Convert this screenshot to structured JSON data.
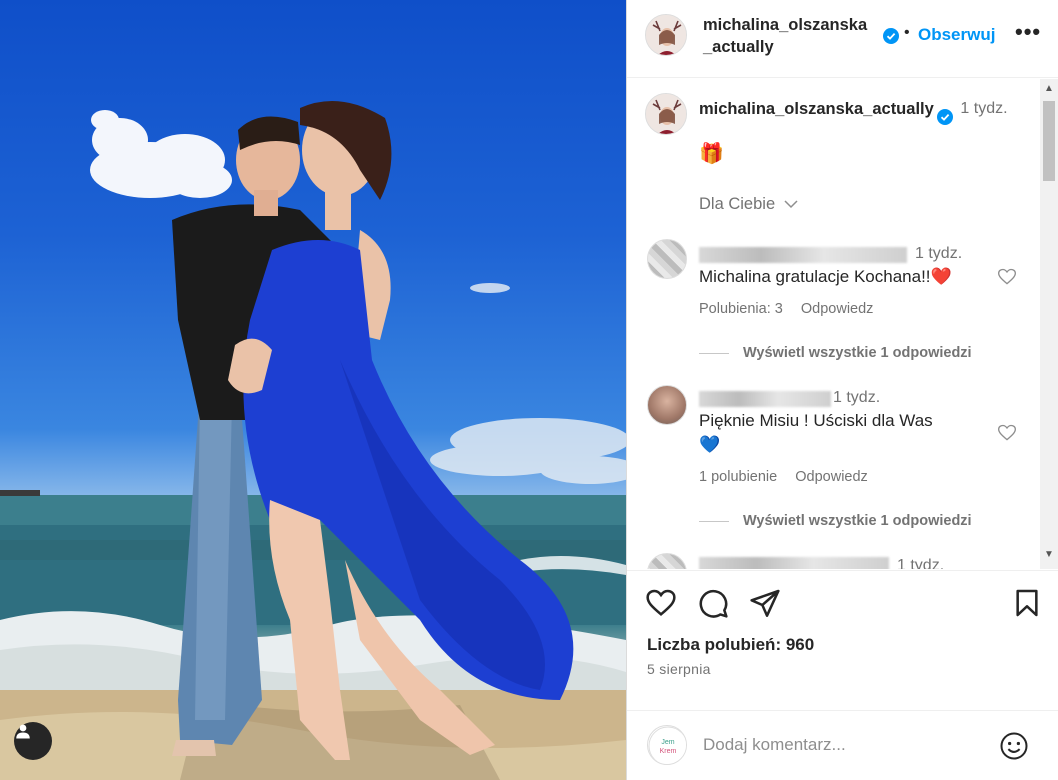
{
  "post": {
    "username": "michalina_olszanska_actually",
    "follow_label": "Obserwuj",
    "separator": "•",
    "more_label": "•••"
  },
  "caption": {
    "username": "michalina_olszanska_actually",
    "time": "1 tydz.",
    "emoji": "🎁"
  },
  "filter": {
    "label": "Dla Ciebie"
  },
  "comments": [
    {
      "time": "1 tydz.",
      "text": "Michalina gratulacje Kochana!!",
      "emoji": "❤️",
      "likes": "Polubienia: 3",
      "reply_label": "Odpowiedz",
      "view_replies": "Wyświetl wszystkie 1 odpowiedzi"
    },
    {
      "time": "1 tydz.",
      "text": "Pięknie Misiu ! Uściski dla Was",
      "emoji": "💙",
      "likes": "1 polubienie",
      "reply_label": "Odpowiedz",
      "view_replies": "Wyświetl wszystkie 1 odpowiedzi"
    },
    {
      "time": "1 tydz."
    }
  ],
  "actions": {
    "like_icon": "heart-icon",
    "comment_icon": "comment-icon",
    "share_icon": "send-icon",
    "save_icon": "bookmark-icon"
  },
  "stats": {
    "likes": "Liczba polubień: 960",
    "date": "5 sierpnia"
  },
  "composer": {
    "avatar_text_1": "Jem",
    "avatar_text_2": "Krem",
    "placeholder": "Dodaj komentarz..."
  },
  "colors": {
    "link_blue": "#0095f6",
    "verified_blue": "#0095f6",
    "text": "#262626",
    "muted": "#737373"
  }
}
